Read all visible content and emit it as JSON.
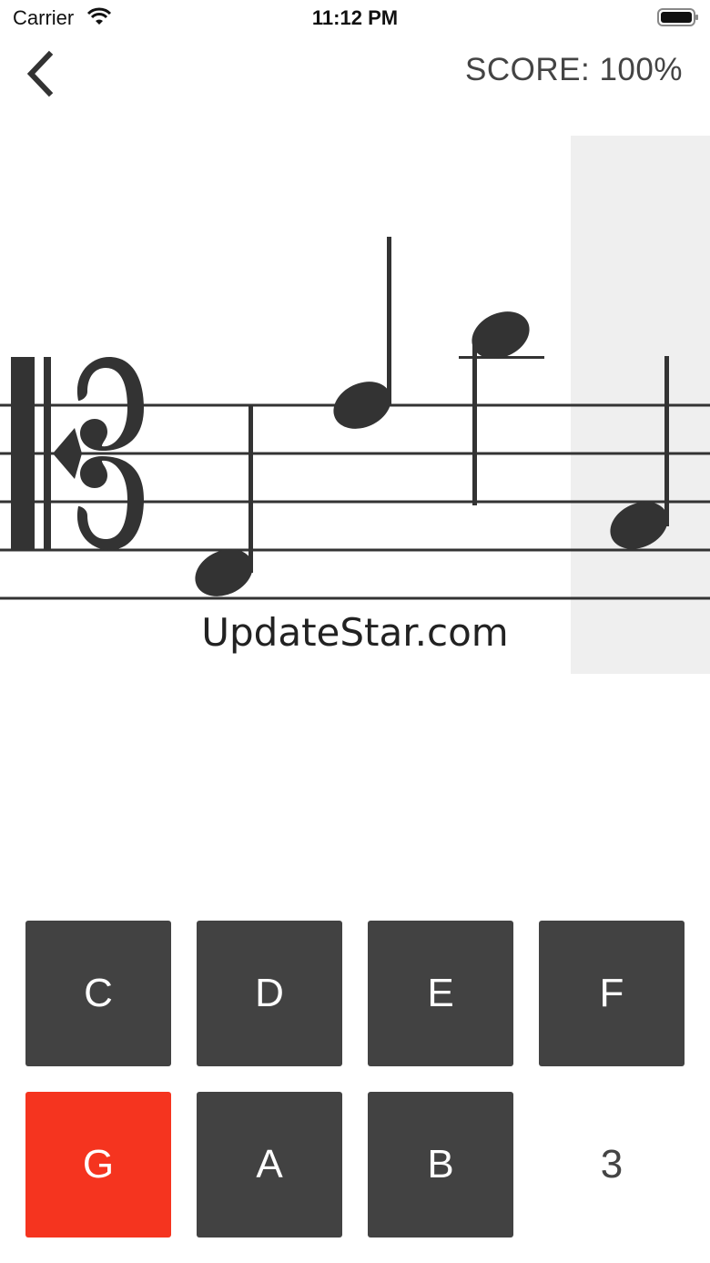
{
  "status_bar": {
    "carrier": "Carrier",
    "time": "11:12 PM",
    "icons": [
      "wifi-icon",
      "battery-icon"
    ]
  },
  "header": {
    "back_icon": "chevron-left-icon",
    "score_label": "SCORE:",
    "score_value": "100%"
  },
  "staff": {
    "clef": "alto-clef",
    "notes": [
      {
        "name": "quarter-note-1",
        "stem": "up"
      },
      {
        "name": "quarter-note-2",
        "stem": "up"
      },
      {
        "name": "quarter-note-3",
        "stem": "down",
        "ledger_line": true
      },
      {
        "name": "quarter-note-4",
        "stem": "up",
        "highlighted": true
      }
    ],
    "watermark": "UpdateStar.com"
  },
  "keys": {
    "row1": [
      "C",
      "D",
      "E",
      "F"
    ],
    "row2": [
      "G",
      "A",
      "B"
    ],
    "wrong_key": "G",
    "counter": "3"
  },
  "colors": {
    "key_bg": "#424242",
    "key_wrong": "#f5341f",
    "highlight": "#efefef",
    "ink": "#333333"
  }
}
